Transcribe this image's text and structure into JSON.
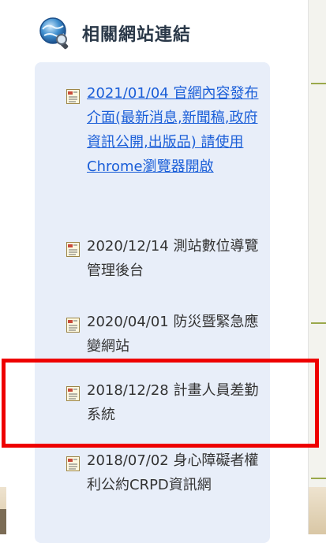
{
  "section": {
    "title": "相關網站連結",
    "icon": "globe-search-icon"
  },
  "links": [
    {
      "text": "2021/01/04 官網內容發布介面(最新消息,新聞稿,政府資訊公開,出版品) 請使用Chrome瀏覽器開啟",
      "style": "hyperlink"
    },
    {
      "text": "2020/12/14 測站數位導覽管理後台",
      "style": "plain"
    },
    {
      "text": "2020/04/01 防災暨緊急應變網站",
      "style": "plain"
    },
    {
      "text": "2018/12/28 計畫人員差勤系統",
      "style": "plain"
    },
    {
      "text": "2018/07/02 身心障礙者權利公約CRPD資訊網",
      "style": "plain"
    }
  ],
  "colors": {
    "link": "#1a5ed8",
    "text": "#333333",
    "panel": "#e8eef9",
    "highlight": "#ee0000"
  }
}
